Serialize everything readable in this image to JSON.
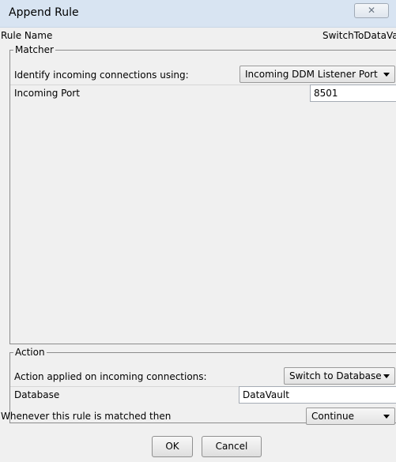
{
  "dialog": {
    "title": "Append Rule",
    "close_glyph": "✕"
  },
  "rule_name": {
    "label": "Rule Name",
    "value": "SwitchToDataVa"
  },
  "matcher": {
    "legend": "Matcher",
    "identify_label": "Identify incoming connections using:",
    "identify_value": "Incoming DDM Listener Port",
    "port_label": "Incoming Port",
    "port_value": "8501"
  },
  "action": {
    "legend": "Action",
    "applied_label": "Action applied on incoming connections:",
    "applied_value": "Switch to Database",
    "database_label": "Database",
    "database_value": "DataVault"
  },
  "whenever": {
    "label": "Whenever this rule is matched then",
    "value": "Continue"
  },
  "buttons": {
    "ok": "OK",
    "cancel": "Cancel"
  },
  "icons": {
    "close": "close-icon",
    "dropdown": "chevron-down-icon"
  }
}
